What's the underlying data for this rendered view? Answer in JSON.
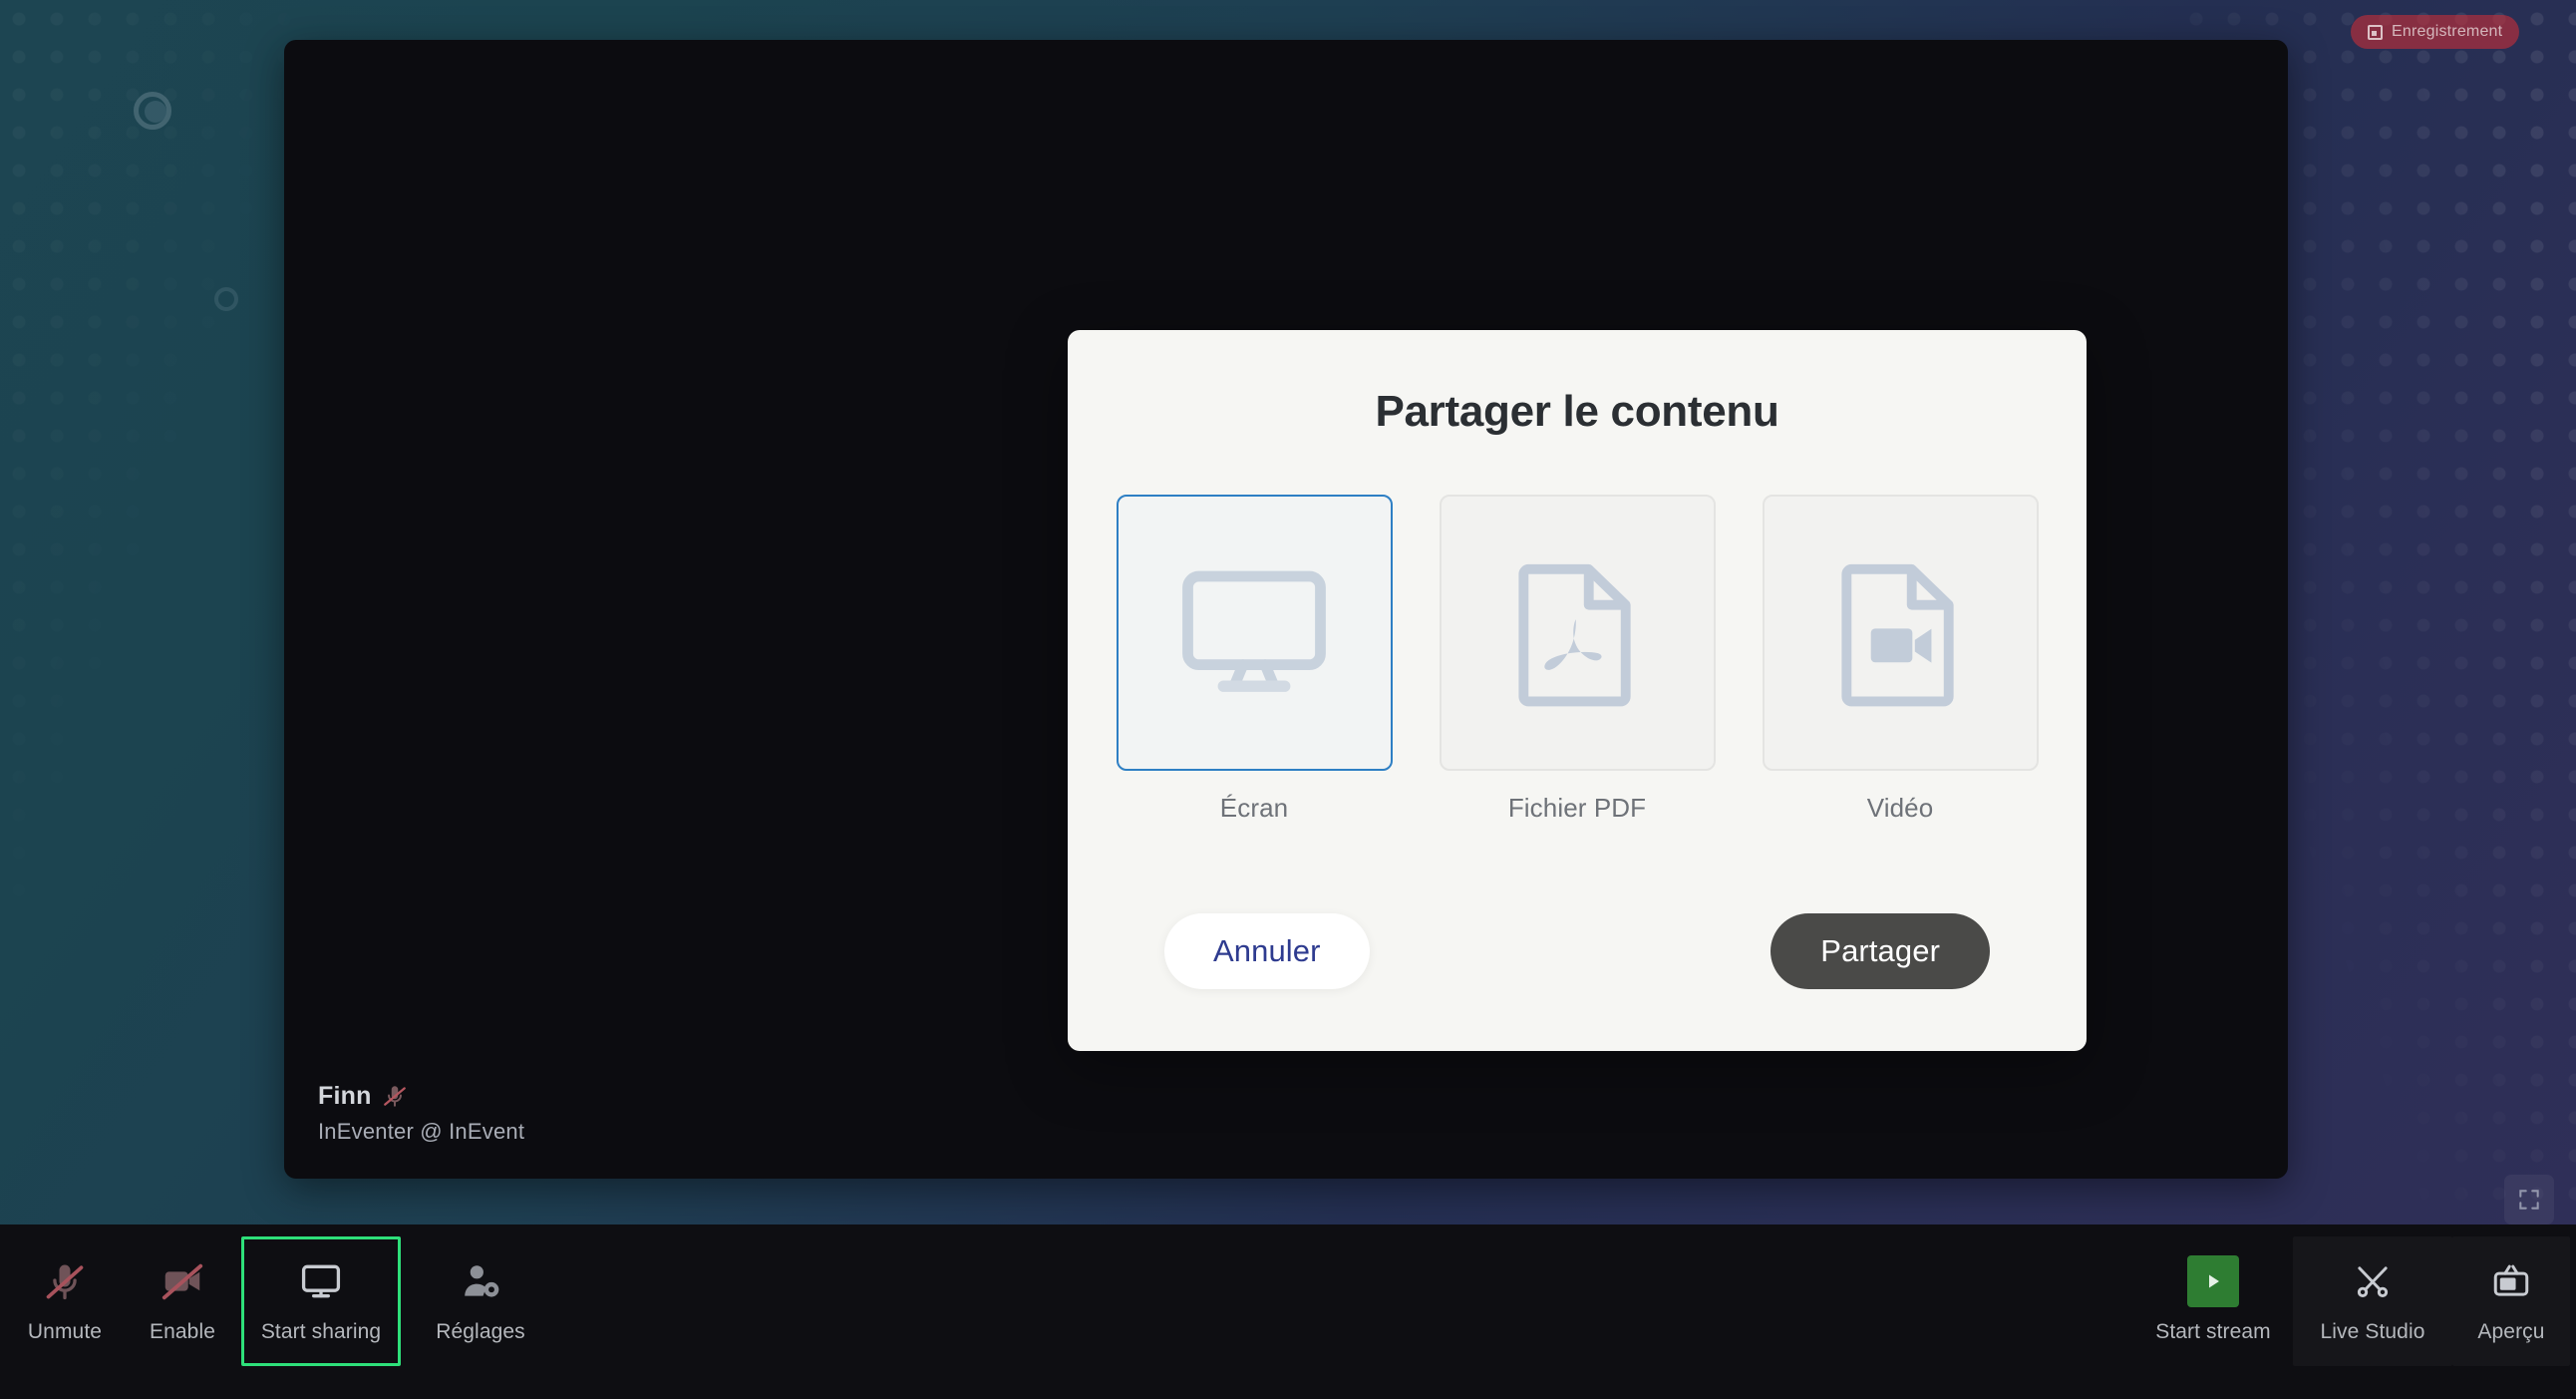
{
  "recording_badge": {
    "label": "Enregistrement",
    "icon": "record-icon",
    "color": "#c42f39"
  },
  "stage": {
    "participant": {
      "name": "Finn",
      "subtitle": "InEventer @ InEvent",
      "mic_icon": "mic-off-icon"
    },
    "fullscreen_icon": "fullscreen-icon"
  },
  "modal": {
    "title": "Partager le contenu",
    "options": [
      {
        "id": "screen",
        "label": "Écran",
        "icon": "monitor-icon",
        "selected": true
      },
      {
        "id": "pdf",
        "label": "Fichier PDF",
        "icon": "pdf-file-icon",
        "selected": false
      },
      {
        "id": "video",
        "label": "Vidéo",
        "icon": "video-file-icon",
        "selected": false
      }
    ],
    "cancel_label": "Annuler",
    "share_label": "Partager",
    "selected_border_color": "#2e7fc4",
    "share_button_color": "#4a4a48",
    "cancel_text_color": "#2e3b8f"
  },
  "toolbar": {
    "left_items": [
      {
        "id": "unmute",
        "label": "Unmute",
        "icon": "mic-off-icon",
        "focused": false
      },
      {
        "id": "enable",
        "label": "Enable",
        "icon": "camera-off-icon",
        "focused": false
      },
      {
        "id": "start-sharing",
        "label": "Start sharing",
        "icon": "screen-share-icon",
        "focused": true
      },
      {
        "id": "settings",
        "label": "Réglages",
        "icon": "user-settings-icon",
        "focused": false
      }
    ],
    "right_items": [
      {
        "id": "start-stream",
        "label": "Start stream",
        "icon": "play-icon",
        "focused": false
      },
      {
        "id": "live-studio",
        "label": "Live Studio",
        "icon": "live-studio-icon",
        "focused": false
      },
      {
        "id": "preview",
        "label": "Aperçu",
        "icon": "tv-icon",
        "focused": false
      }
    ],
    "focus_color": "#2ee07a",
    "background_color": "#0e0e12"
  }
}
